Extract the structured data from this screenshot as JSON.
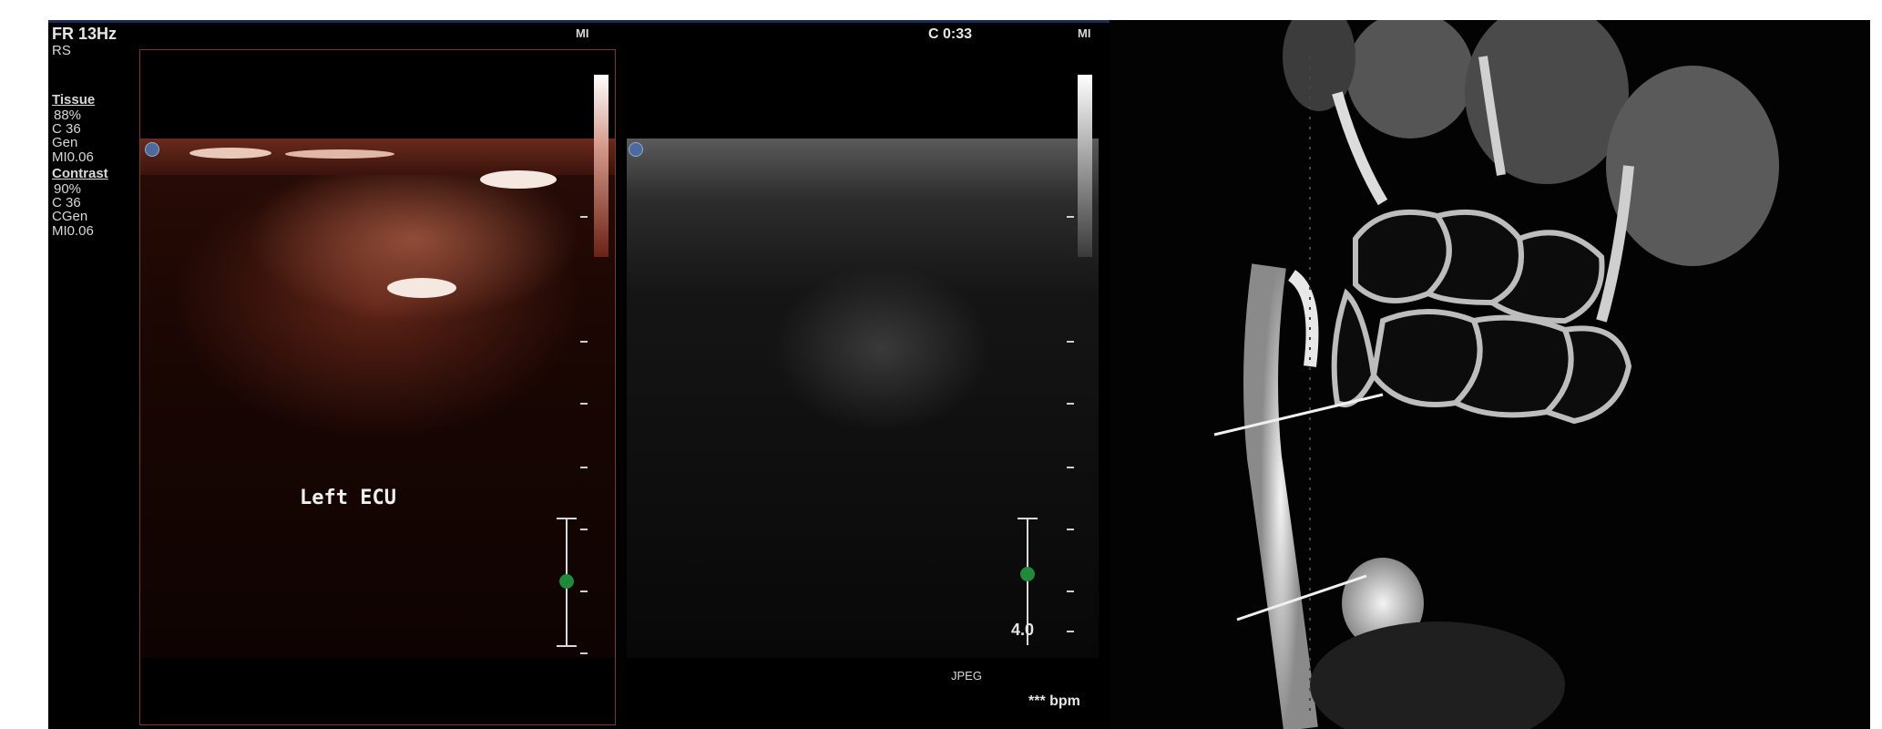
{
  "ultrasound": {
    "frame_rate": "FR 13Hz",
    "rs": "RS",
    "tissue": {
      "heading": "Tissue",
      "gain": "88%",
      "c": "C 36",
      "mode": "Gen",
      "mi": "MI0.06"
    },
    "contrast": {
      "heading": "Contrast",
      "gain": "90%",
      "c": "C 36",
      "mode": "CGen",
      "mi": "MI0.06"
    },
    "mi_label_left": "MI",
    "timer": "C 0:33",
    "mi_label_right": "MI",
    "structure_label": "Left  ECU",
    "depth": "4.0",
    "format": "JPEG",
    "heart_rate": "*** bpm",
    "colors": {
      "contrast_tint": "#8a3a24",
      "caliper_marker": "#1f8a3a"
    }
  },
  "mri": {
    "annotations": [
      "arrow",
      "arrow"
    ]
  }
}
